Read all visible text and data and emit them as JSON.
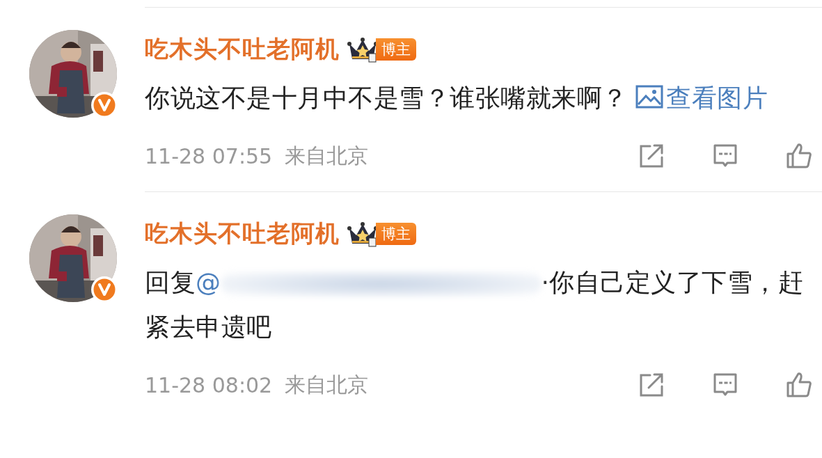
{
  "comments": [
    {
      "author": "吃木头不吐老阿机",
      "verified": true,
      "badge": "博主",
      "text": "你说这不是十月中不是雪？谁张嘴就来啊？",
      "image_link": "查看图片",
      "time": "11-28 07:55",
      "source": "来自北京"
    },
    {
      "author": "吃木头不吐老阿机",
      "verified": true,
      "badge": "博主",
      "reply_prefix": "回复",
      "mention": "@",
      "redacted": true,
      "text": "·你自己定义了下雪，赶紧去申遗吧",
      "time": "11-28 08:02",
      "source": "来自北京"
    }
  ]
}
